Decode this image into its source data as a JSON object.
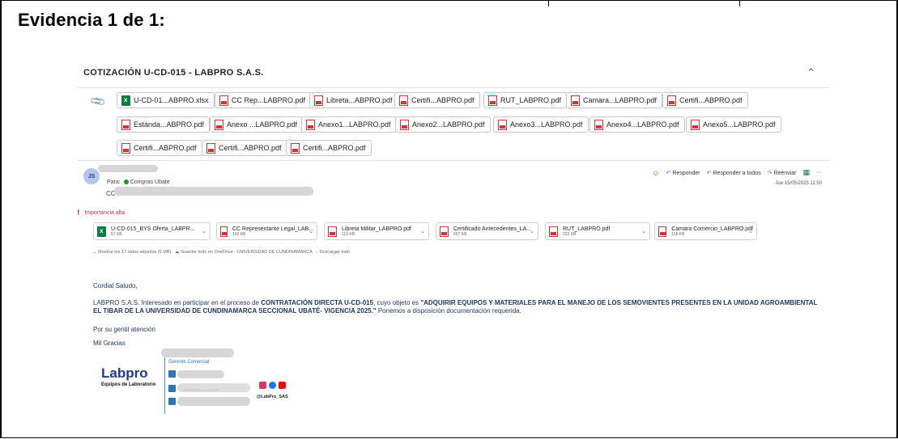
{
  "document": {
    "heading": "Evidencia 1 de 1:"
  },
  "email": {
    "subject": "COTIZACIÓN U-CD-015 - LABPRO S.A.S.",
    "collapse_icon": "chevron-up-icon",
    "attachment_chips": [
      {
        "name": "U-CD-01...ABPRO.xlsx",
        "type": "xlsx"
      },
      {
        "name": "CC Rep...LABPRO.pdf",
        "type": "pdf"
      },
      {
        "name": "Libreta...ABPRO.pdf",
        "type": "pdf"
      },
      {
        "name": "Certifi...ABPRO.pdf",
        "type": "pdf"
      },
      {
        "name": "RUT_LABPRO.pdf",
        "type": "pdf"
      },
      {
        "name": "Camara...LABPRO.pdf",
        "type": "pdf"
      },
      {
        "name": "Certifi...ABPRO.pdf",
        "type": "pdf"
      },
      {
        "name": "Estánda...ABPRO.pdf",
        "type": "pdf"
      },
      {
        "name": "Anexo ...LABPRO.pdf",
        "type": "pdf"
      },
      {
        "name": "Anexo1...LABPRO.pdf",
        "type": "pdf"
      },
      {
        "name": "Anexo2...LABPRO.pdf",
        "type": "pdf"
      },
      {
        "name": "Anexo3...LABPRO.pdf",
        "type": "pdf"
      },
      {
        "name": "Anexo4...LABPRO.pdf",
        "type": "pdf"
      },
      {
        "name": "Anexo5...LABPRO.pdf",
        "type": "pdf"
      },
      {
        "name": "Certifi...ABPRO.pdf",
        "type": "pdf"
      },
      {
        "name": "Certifi...ABPRO.pdf",
        "type": "pdf"
      },
      {
        "name": "Certifi...ABPRO.pdf",
        "type": "pdf"
      }
    ],
    "message": {
      "avatar_initials": "JS",
      "to_label": "Para:",
      "to_value": "Compras Ubate",
      "cc_label": "CC",
      "actions": {
        "reply": "Responder",
        "reply_all": "Responder a todos",
        "forward": "Reenviar",
        "more": "···"
      },
      "date": "Jue 15/05/2025 11:50",
      "importance": "Importancia alta",
      "attachments": [
        {
          "name": "U-CD-015_BYS Oferta_LABPR...",
          "size": "57 KB",
          "type": "xlsx"
        },
        {
          "name": "CC Representante Legal_LAB...",
          "size": "142 KB",
          "type": "pdf"
        },
        {
          "name": "Libreta Militar_LABPRO.pdf",
          "size": "119 KB",
          "type": "pdf"
        },
        {
          "name": "Certificado Antecedentes_LA...",
          "size": "667 KB",
          "type": "pdf"
        },
        {
          "name": "RUT_LABPRO.pdf",
          "size": "222 KB",
          "type": "pdf"
        },
        {
          "name": "Camara Comercio_LABPRO.pdf",
          "size": "156 KB",
          "type": "pdf"
        }
      ],
      "show_all": "Mostrar los 17 datos adjuntos (6 MB)",
      "save_onedrive": "Guardar todo en OneDrive - UNIVERSIDAD DE CUNDINAMARCA",
      "download_all": "Descargar todo",
      "body": {
        "greeting": "Cordial Saludo,",
        "p1_start": "LABPRO S.A.S. Interesado en participar en el proceso de ",
        "p1_bold": "CONTRATACIÓN DIRECTA U-CD-015",
        "p1_mid": ", cuyo objeto es ",
        "p1_quote": "\"ADQUIRIR EQUIPOS Y MATERIALES PARA EL MANEJO DE LOS SEMOVIENTES PRESENTES EN LA UNIDAD AGROAMBIENTAL EL TIBAR DE LA UNIVERSIDAD DE CUNDINAMARCA SECCIONAL UBATÉ- VIGENCIA 2025.\"",
        "p1_end": " Ponemos a disposición documentación requerida.",
        "thanks": "Por su gentil atención",
        "closing": "Mil Gracias"
      },
      "signature": {
        "role": "Gerente Comercial",
        "logo": "Labpro",
        "logo_tagline": "Equipos de Laboratorio",
        "website": "www.labpro.com.co",
        "handle": "@LabPro_SAS"
      }
    }
  }
}
